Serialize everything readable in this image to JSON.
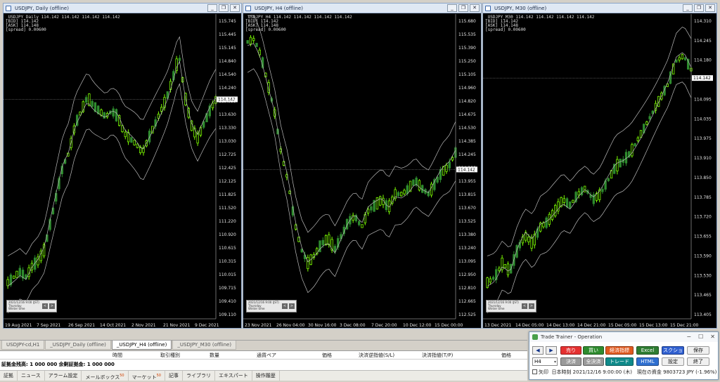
{
  "charts": [
    {
      "title": "USDJPY, Daily (offline)",
      "info": [
        "_USDJPY_Daily  114.142 114.142 114.142 114.142",
        "[BID] 114.142",
        "[ASK] 114.148",
        "[spread] 0.00600"
      ],
      "price_label": "114.142",
      "yticks": [
        "115.745",
        "115.445",
        "115.145",
        "114.840",
        "114.540",
        "114.240",
        "113.935",
        "113.630",
        "113.330",
        "113.030",
        "112.725",
        "112.425",
        "112.125",
        "111.825",
        "111.520",
        "111.220",
        "110.920",
        "110.615",
        "110.315",
        "110.015",
        "109.715",
        "109.410",
        "109.110"
      ],
      "xticks": [
        "19 Aug 2021",
        "7 Sep 2021",
        "26 Sep 2021",
        "14 Oct 2021",
        "2 Nov 2021",
        "21 Nov 2021",
        "9 Dec 2021"
      ]
    },
    {
      "title": "USDJPY, H4 (offline)",
      "info": [
        "_USDJPY_H4  114.142 114.142 114.142 114.142",
        "[BID] 114.142",
        "[ASK] 114.148",
        "[spread] 0.00600"
      ],
      "price_label": "114.142",
      "yticks": [
        "115.680",
        "115.535",
        "115.390",
        "115.250",
        "115.105",
        "114.960",
        "114.820",
        "114.675",
        "114.530",
        "114.385",
        "114.245",
        "114.100",
        "113.955",
        "113.815",
        "113.670",
        "113.525",
        "113.380",
        "113.240",
        "113.095",
        "112.950",
        "112.810",
        "112.665",
        "112.525"
      ],
      "xticks": [
        "23 Nov 2021",
        "26 Nov 04:00",
        "30 Nov 16:00",
        "3 Dec 08:00",
        "7 Dec 20:00",
        "10 Dec 12:00",
        "15 Dec 00:00"
      ]
    },
    {
      "title": "USDJPY, M30 (offline)",
      "info": [
        "_USDJPY_M30  114.142 114.142 114.142 114.142",
        "[BID] 114.142",
        "[ASK] 114.148",
        "[spread] 0.00600"
      ],
      "price_label": "114.142",
      "yticks": [
        "114.310",
        "114.245",
        "114.180",
        "114.142",
        "114.095",
        "114.035",
        "113.975",
        "113.910",
        "113.850",
        "113.785",
        "113.720",
        "113.655",
        "113.590",
        "113.530",
        "113.465",
        "113.405"
      ],
      "xticks": [
        "13 Dec 2021",
        "14 Dec 05:00",
        "14 Dec 13:00",
        "14 Dec 21:00",
        "15 Dec 05:00",
        "15 Dec 13:00",
        "15 Dec 21:00"
      ]
    }
  ],
  "inset": {
    "line1": "2021/12/16 9:00 (JST)",
    "line2": "Thursday",
    "line3": "Winter time"
  },
  "tabs": [
    "USDJPY-cd,H1",
    "_USDJPY_Daily (offline)",
    "_USDJPY_H4 (offline)",
    "_USDJPY_M30 (offline)"
  ],
  "active_tab": 2,
  "terminal": {
    "headers": [
      "時間",
      "取引種別",
      "数量",
      "通貨ペア",
      "価格",
      "決済逆指値(S/L)",
      "決済指値(T/P)",
      "価格"
    ],
    "balance_row": "証拠金残高: 1 000 000  余剰証拠金: 1 000 000",
    "tabs": [
      {
        "label": "証拠",
        "badge": ""
      },
      {
        "label": "ニュース",
        "badge": ""
      },
      {
        "label": "アラーム設定",
        "badge": ""
      },
      {
        "label": "メールボックス",
        "badge": "50"
      },
      {
        "label": "マーケット",
        "badge": "50"
      },
      {
        "label": "記事",
        "badge": ""
      },
      {
        "label": "ライブラリ",
        "badge": ""
      },
      {
        "label": "エキスパート",
        "badge": ""
      },
      {
        "label": "操作履歴",
        "badge": ""
      }
    ]
  },
  "trainer": {
    "title": "Trade Trainer - Operation",
    "btn_sell": "売り",
    "btn_buy": "買い",
    "btn_econ": "経済指標",
    "btn_excel": "Excel",
    "btn_screenshot": "スクショ",
    "btn_save": "保存",
    "btn_settle": "決済",
    "btn_settle_all": "全決済",
    "btn_trade": "トレード",
    "btn_html": "HTML",
    "btn_settings": "設定",
    "btn_end": "終了",
    "timeframe": "H4",
    "arrow_label": "矢印",
    "status": "日本時刻 2021/12/16 9:00:00 (木)　現在の資金 9803723 JPY (-1.96%)",
    "colors": {
      "sell": "#e53030",
      "buy": "#2e8b2e",
      "econ": "#e05a20",
      "excel": "#2e7d32",
      "screenshot": "#2f5fd0",
      "settle": "#9a9a9a",
      "trade": "#0f8a8a",
      "html": "#2f6fd0"
    }
  }
}
